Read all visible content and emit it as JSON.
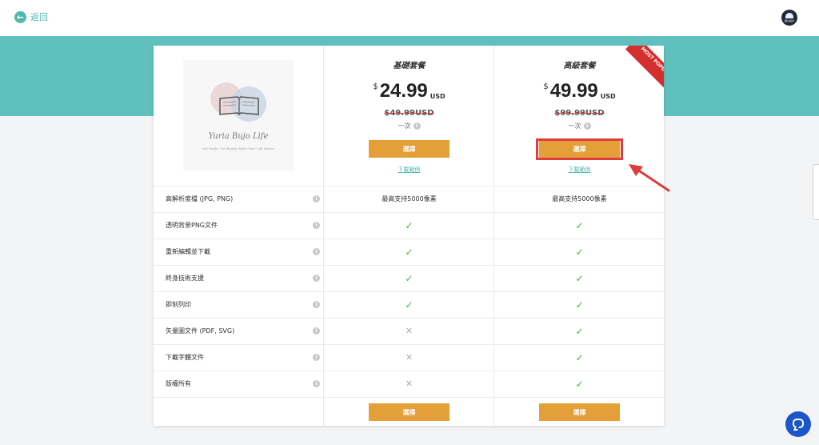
{
  "header": {
    "back_label": "返回",
    "avatar_brand": "國立設計"
  },
  "brand": {
    "logo_name": "Yuria Bujo Life",
    "logo_tagline": "Get Goals. Get Ready. Make Your Life Better."
  },
  "plans": [
    {
      "name": "基礎套餐",
      "currency": "$",
      "price": "24.99",
      "unit": "USD",
      "original_price": "$49.99USD",
      "billing": "一次",
      "select_label": "選擇",
      "sample_link": "下載範例",
      "bottom_select_label": "選擇"
    },
    {
      "name": "高級套餐",
      "currency": "$",
      "price": "49.99",
      "unit": "USD",
      "original_price": "$99.99USD",
      "billing": "一次",
      "select_label": "選擇",
      "sample_link": "下載範例",
      "bottom_select_label": "選擇",
      "badge": "MOST POPULAR"
    }
  ],
  "features": [
    {
      "label": "高解析度檔 (JPG, PNG)",
      "basic": "最高支持5000像素",
      "premium": "最高支持5000像素"
    },
    {
      "label": "透明背景PNG文件",
      "basic": "check",
      "premium": "check"
    },
    {
      "label": "重新編輯並下載",
      "basic": "check",
      "premium": "check"
    },
    {
      "label": "終身技術支援",
      "basic": "check",
      "premium": "check"
    },
    {
      "label": "即刻列印",
      "basic": "check",
      "premium": "check"
    },
    {
      "label": "矢量圖文件 (PDF, SVG)",
      "basic": "cross",
      "premium": "check"
    },
    {
      "label": "下載字體文件",
      "basic": "cross",
      "premium": "check"
    },
    {
      "label": "版權所有",
      "basic": "cross",
      "premium": "check"
    }
  ],
  "icons": {
    "back": "arrow-left-icon",
    "info": "info-icon",
    "check": "check-icon",
    "cross": "cross-icon",
    "chat": "chat-icon",
    "annotation": "red-arrow-icon"
  },
  "colors": {
    "accent_teal": "#5fc0be",
    "button_orange": "#e49f38",
    "ribbon_red": "#d32f2f",
    "check_green": "#4cae4c",
    "highlight_red": "#e03c3c",
    "chat_blue": "#1d56c6"
  }
}
